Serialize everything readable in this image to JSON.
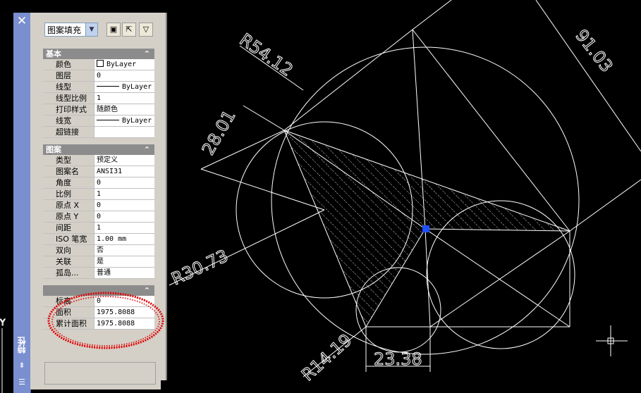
{
  "panel": {
    "title_vertical": "特性",
    "close_glyph": "✕",
    "selector_value": "图案填充"
  },
  "sections": {
    "basic": {
      "header": "基本",
      "rows": [
        {
          "key": "颜色",
          "value": "ByLayer",
          "kind": "color"
        },
        {
          "key": "图层",
          "value": "0",
          "kind": "text"
        },
        {
          "key": "线型",
          "value": "ByLayer",
          "kind": "line"
        },
        {
          "key": "线型比例",
          "value": "1",
          "kind": "text"
        },
        {
          "key": "打印样式",
          "value": "随颜色",
          "kind": "text"
        },
        {
          "key": "线宽",
          "value": "ByLayer",
          "kind": "line"
        },
        {
          "key": "超链接",
          "value": "",
          "kind": "text"
        }
      ]
    },
    "pattern": {
      "header": "图案",
      "rows": [
        {
          "key": "类型",
          "value": "预定义"
        },
        {
          "key": "图案名",
          "value": "ANSI31"
        },
        {
          "key": "角度",
          "value": "0"
        },
        {
          "key": "比例",
          "value": "1"
        },
        {
          "key": "原点 X",
          "value": "0"
        },
        {
          "key": "原点 Y",
          "value": "0"
        },
        {
          "key": "间距",
          "value": "1"
        },
        {
          "key": "ISO 笔宽",
          "value": "1.00 mm"
        },
        {
          "key": "双向",
          "value": "否"
        },
        {
          "key": "关联",
          "value": "是"
        },
        {
          "key": "孤岛...",
          "value": "普通"
        }
      ]
    },
    "geometry": {
      "header": "",
      "rows": [
        {
          "key": "标高",
          "value": "0"
        },
        {
          "key": "面积",
          "value": "1975.8088"
        },
        {
          "key": "累计面积",
          "value": "1975.8088"
        }
      ]
    }
  },
  "dimensions": {
    "d1": "R54.12",
    "d2": "91.03",
    "d3": "28.01",
    "d4": "R30.73",
    "d5": "R14.19",
    "d6": "23.38"
  },
  "ucs_label": "Y",
  "colors": {
    "panel_bg": "#d4d0c8",
    "strip": "#7a8fd0",
    "grip": "#1f4fff",
    "annotation": "#e00000"
  }
}
